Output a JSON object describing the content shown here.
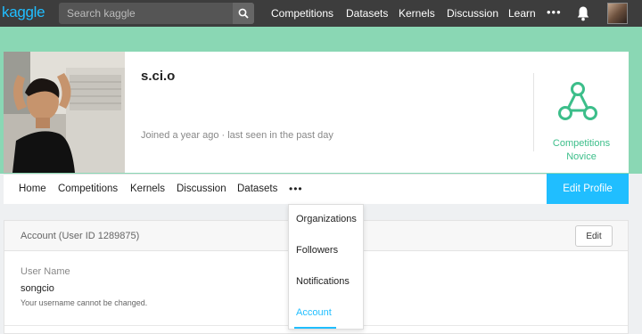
{
  "topbar": {
    "logo": "kaggle",
    "search_placeholder": "Search kaggle",
    "nav": [
      "Competitions",
      "Datasets",
      "Kernels",
      "Discussion",
      "Learn"
    ],
    "more": "•••"
  },
  "profile": {
    "username": "s.ci.o",
    "joined": "Joined a year ago · last seen in the past day",
    "tier_line1": "Competitions",
    "tier_line2": "Novice",
    "tier_color": "#3cbe8a"
  },
  "tabs": {
    "items": [
      "Home",
      "Competitions",
      "Kernels",
      "Discussion",
      "Datasets"
    ],
    "more": "•••",
    "edit_profile": "Edit Profile"
  },
  "account": {
    "title": "Account (User ID 1289875)",
    "edit": "Edit",
    "field_label": "User Name",
    "field_value": "songcio",
    "field_help": "Your username cannot be changed."
  },
  "dropdown": {
    "items": [
      "Organizations",
      "Followers",
      "Notifications",
      "Account"
    ]
  },
  "colors": {
    "accent": "#20beff",
    "band": "#8ad7b4",
    "topbar": "#3d3d3d"
  }
}
